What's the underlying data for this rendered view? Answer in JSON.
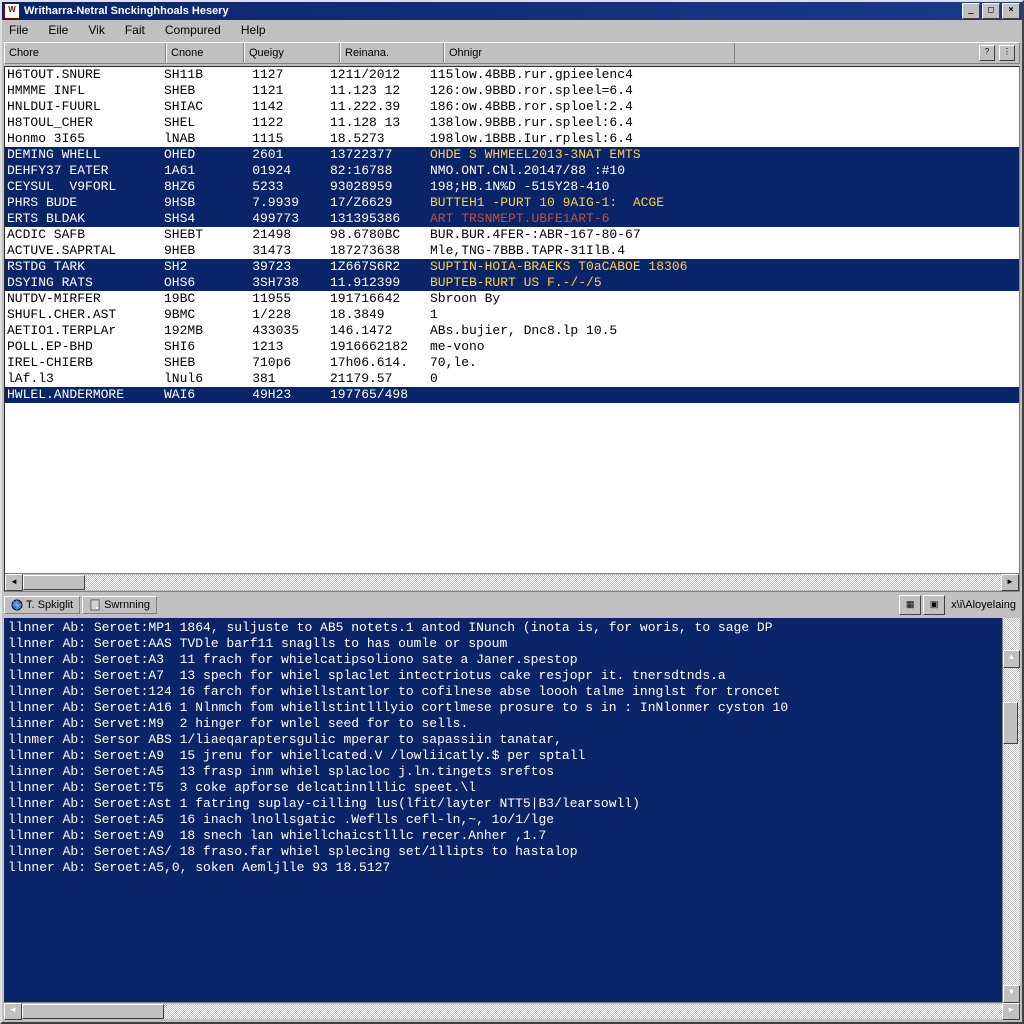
{
  "window": {
    "title": "Writharra-Netral  Snckinghhoals Hesery"
  },
  "win_btn": {
    "min": "_",
    "max": "□",
    "close": "×"
  },
  "menu": {
    "file": "File",
    "eile": "Eile",
    "vik": "Vik",
    "fait": "Fait",
    "compured": "Compured",
    "help": "Help"
  },
  "headers": {
    "c0": "Chore",
    "c1": "Cnone",
    "c2": "Queigy",
    "c3": "Reinana.",
    "c4": "Ohnigr",
    "end_q": "?",
    "end_more": "⋮"
  },
  "tabs": {
    "a": {
      "label": "T. Spkiglit",
      "icon": "globe-icon"
    },
    "b": {
      "label": "Swrnning",
      "icon": "doc-icon"
    },
    "side_a": "▦",
    "side_b": "▣",
    "logtext": "x\\i\\Aloyelaing"
  },
  "rows": [
    {
      "sel": false,
      "c0": "H6TOUT.SNURE",
      "c1": "SH11B",
      "c2": "1",
      "c3": "127",
      "c4": "1211/2012",
      "c5": "115low.4BBB.rur.gpieelenc4"
    },
    {
      "sel": false,
      "c0": "HMMME INFL",
      "c1": "SHEB",
      "c2": "1",
      "c3": "121",
      "c4": "11.123 12",
      "c5": "126:ow.9BBD.ror.spleel=6.4"
    },
    {
      "sel": false,
      "c0": "HNLDUI-FUURL",
      "c1": "SHIAC",
      "c2": "1",
      "c3": "142",
      "c4": "11.222.39",
      "c5": "186:ow.4BBB.ror.sploel:2.4"
    },
    {
      "sel": false,
      "c0": "H8TOUL_CHER",
      "c1": "SHEL",
      "c2": "1",
      "c3": "122",
      "c4": "11.128 13",
      "c5": "138low.9BBB.rur.spleel:6.4"
    },
    {
      "sel": false,
      "c0": "Honmo 3I65",
      "c1": "lNAB",
      "c2": "1",
      "c3": "115",
      "c4": "18.5273",
      "c5": "198low.1BBB.Iur.rplesl:6.4"
    },
    {
      "sel": true,
      "c0": "DEMING WHELL",
      "c1": "OHED",
      "c2": "2",
      "c3": "601",
      "c4": "13722377",
      "c5": "OHDE S WHMEEL2013-3NAT EMTS",
      "yellow": true
    },
    {
      "sel": true,
      "c0": "DEHFY37 EATER",
      "c1": "1A61",
      "c2": "0",
      "c3": "1924",
      "c4": "82:16788",
      "c5": "NMO.ONT.CNl.20147/88 :#10"
    },
    {
      "sel": true,
      "c0": "CEYSUL  V9FORL",
      "c1": "8HZ6",
      "c2": "5",
      "c3": "233",
      "c4": "93028959",
      "c5": "198;HB.1N%D -515Y28-410"
    },
    {
      "sel": true,
      "c0": "PHRS BUDE",
      "c1": "9HSB",
      "c2": "7",
      "c3": ".9939",
      "c4": "17/Z6629",
      "c5": "BUTTEH1 -PURT 10 9AIG-1:  ACGE",
      "yellow": true
    },
    {
      "sel": true,
      "c0": "ERTS BLDAK",
      "c1": "SHS4",
      "c2": "4",
      "c3": "99773",
      "c4": "131395386",
      "c5": "ART TRSNMEPT.UBFE1ART-6",
      "tint": true
    },
    {
      "sel": false,
      "c0": "ACDIC SAFB",
      "c1": "SHEBT",
      "c2": "2",
      "c3": "1498",
      "c4": "98.6780BC",
      "c5": "BUR.BUR.4FER-:ABR-167-80-67"
    },
    {
      "sel": false,
      "c0": "ACTUVE.SAPRTAL",
      "c1": "9HEB",
      "c2": "3",
      "c3": "1473",
      "c4": "187273638",
      "c5": "Mle,TNG-7BBB.TAPR-31IlB.4"
    },
    {
      "sel": true,
      "c0": "RSTDG TARK",
      "c1": "SH2",
      "c2": "3",
      "c3": "9723",
      "c4": "1Z667S6R2",
      "c5": "SUPTIN-HOIA-BRAEKS T0aCABOE 18306",
      "yellow": true
    },
    {
      "sel": true,
      "c0": "DSYING RATS",
      "c1": "OHS6",
      "c2": "3",
      "c3": "SH738",
      "c4": "11.912399",
      "c5": "BUPTEB-RURT US F.-/-/5",
      "yellow": true
    },
    {
      "sel": false,
      "c0": "NUTDV-MIRFER",
      "c1": "19BC",
      "c2": "1",
      "c3": "1955",
      "c4": "191716642",
      "c5": "Sbroon By"
    },
    {
      "sel": false,
      "c0": "SHUFL.CHER.AST",
      "c1": "9BMC",
      "c2": "1",
      "c3": "/228",
      "c4": "18.3849",
      "c5": "1"
    },
    {
      "sel": false,
      "c0": "AETIO1.TERPLAr",
      "c1": "192MB",
      "c2": "4",
      "c3": "33035",
      "c4": "146.1472",
      "c5": "ABs.bujier, Dnc8.lp 10.5"
    },
    {
      "sel": false,
      "c0": "POLL.EP-BHD",
      "c1": "SHI6",
      "c2": "1",
      "c3": "213",
      "c4": "1916662182",
      "c5": "me-vono"
    },
    {
      "sel": false,
      "c0": "IREL-CHIERB",
      "c1": "SHEB",
      "c2": "7",
      "c3": "10p6",
      "c4": "17h06.614.",
      "c5": "70,le."
    },
    {
      "sel": false,
      "c0": "lAf.l3",
      "c1": "lNul6",
      "c2": "3",
      "c3": "81",
      "c4": "21179.57",
      "c5": "0"
    },
    {
      "sel": true,
      "c0": "HWLEL.ANDERMORE",
      "c1": "WAI6",
      "c2": "4",
      "c3": "9H23",
      "c4": "197765/498",
      "c5": ""
    }
  ],
  "console_lines": [
    "llnner Ab: Seroet:MP1 1864, suljuste to AB5 notets.1 antod INunch (inota is, for woris, to sage DP",
    "llnner Ab: Seroet:AAS TVDle barf11 snaglls to has oumle or spoum",
    "llnner Ab: Seroet:A3  11 frach for whielcatipsoliono sate a Janer.spestop",
    "llnner Ab: Seroet:A7  13 spech for whiel splaclet intectriotus cake resjopr it. tnersdtnds.a",
    "llnner Ab: Seroet:124 16 farch for whiellstantlor to cofilnese abse loooh talme innglst for troncet",
    "llnner Ab: Seroet:A16 1 Nlnmch fom whiellstintlllyio cortlmese prosure to s in : InNlonmer cyston 10",
    "linner Ab: Servet:M9  2 hinger for wnlel seed for to sells.",
    "",
    "llnmer Ab: Sersor ABS 1/liaeqaraptersgulic mperar to sapassiin tanatar,",
    "llnner Ab: Seroet:A9  15 jrenu for whiellcated.V /lowliicatly.$ per sptall",
    "linner Ab: Seroet:A5  13 frasp inm whiel splacloc j.ln.tingets sreftos",
    "llnner Ab: Seroet:T5  3 coke apforse delcatinnlllic speet.\\l",
    "llnner Ab: Seroet:Ast 1 fatring suplay-cilling lus(lfit/layter NTT5|B3/learsowll)",
    "llnner Ab: Seroet:A5  16 inach lnollsgatic .Weflls cefl-ln,~, 1o/1/lge",
    "llnner Ab: Seroet:A9  18 snech lan whiellchaicstlllc recer.Anher ,1.7",
    "llnner Ab: Seroet:AS/ 18 fraso.far whiel splecing set/1llipts to hastalop",
    "llnner Ab: Seroet:A5,0, soken Aemljlle 93 18.5127"
  ]
}
